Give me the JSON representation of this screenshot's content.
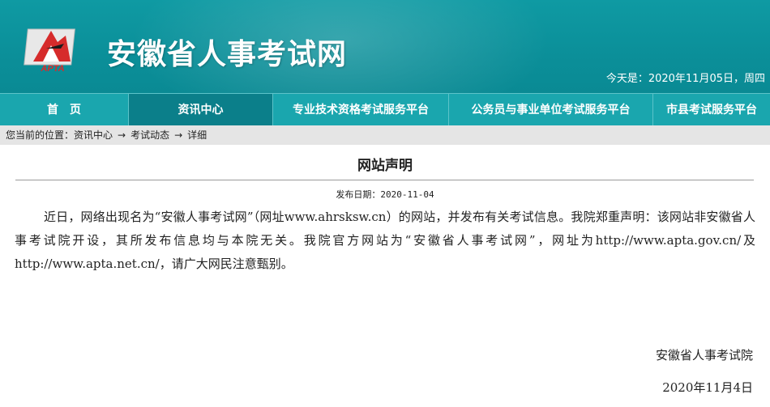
{
  "header": {
    "site_title": "安徽省人事考试网",
    "logo_text": "APTA",
    "date_label": "今天是：",
    "date_value": "2020年11月05日，周四"
  },
  "nav": {
    "items": [
      {
        "label": "首　页"
      },
      {
        "label": "资讯中心"
      },
      {
        "label": "专业技术资格考试服务平台"
      },
      {
        "label": "公务员与事业单位考试服务平台"
      },
      {
        "label": "市县考试服务平台"
      }
    ],
    "active_index": 1
  },
  "breadcrumb": {
    "prefix": "您当前的位置：",
    "items": [
      "资讯中心",
      "考试动态",
      "详细"
    ],
    "separator": "→"
  },
  "article": {
    "title": "网站声明",
    "publish_date": "发布日期：2020-11-04",
    "body": "近日，网络出现名为“安徽人事考试网”（网址www.ahrsksw.cn）的网站，并发布有关考试信息。我院郑重声明：该网站非安徽省人事考试院开设，其所发布信息均与本院无关。我院官方网站为“安徽省人事考试网”，网址为http://www.apta.gov.cn/及http://www.apta.net.cn/，请广大网民注意甄别。",
    "signature": "安徽省人事考试院",
    "sign_date": "2020年11月4日"
  },
  "colors": {
    "header_bg": "#0f9aa3",
    "nav_bg": "#1aa6ae",
    "nav_active": "#0b7f8a",
    "logo_red": "#d62b2b"
  }
}
